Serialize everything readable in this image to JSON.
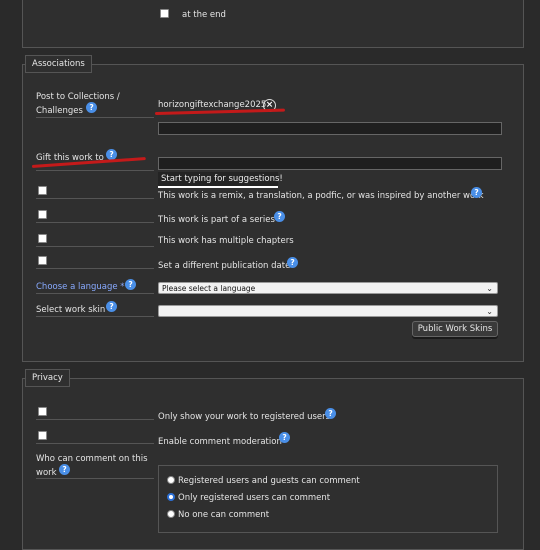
{
  "top": {
    "at_end_label": "at the end"
  },
  "associations": {
    "legend": "Associations",
    "collections_label_line1": "Post to Collections /",
    "collections_label_line2": "Challenges",
    "collection_tag": "horizongiftexchange2025",
    "remove_glyph": "×",
    "gift_label": "Gift this work to",
    "gift_suggestion": "Start typing for suggestions!",
    "remix_label": "This work is a remix, a translation, a podfic, or was inspired by another work",
    "series_label": "This work is part of a series",
    "chapters_label": "This work has multiple chapters",
    "pubdate_label": "Set a different publication date",
    "language_label": "Choose a language *",
    "language_value": "Please select a language",
    "skin_label": "Select work skin",
    "skin_value": "",
    "public_skins_button": "Public Work Skins"
  },
  "privacy": {
    "legend": "Privacy",
    "registered_only_label": "Only show your work to registered users",
    "moderation_label": "Enable comment moderation",
    "who_comment_line1": "Who can comment on this",
    "who_comment_line2": "work",
    "options": [
      "Registered users and guests can comment",
      "Only registered users can comment",
      "No one can comment"
    ],
    "selected_option": "Only registered users can comment"
  },
  "help_glyph": "?",
  "colors": {
    "help": "#4a8fe7",
    "link": "#88aaff",
    "annotation": "#c41a1a",
    "radio_on": "#2b6fd6"
  }
}
